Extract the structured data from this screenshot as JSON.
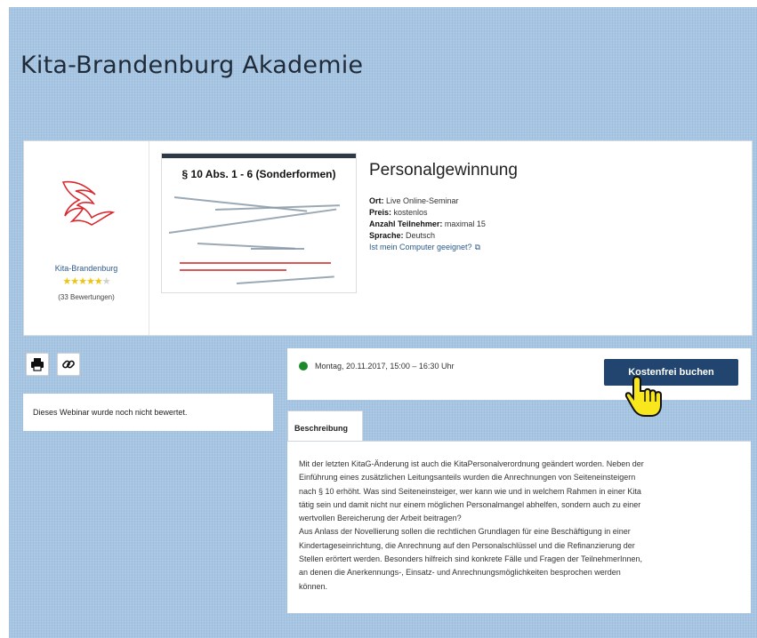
{
  "page": {
    "title": "Kita-Brandenburg Akademie"
  },
  "provider": {
    "name": "Kita-Brandenburg",
    "rating_stars": 5,
    "rating_count_text": "(33 Bewertungen)"
  },
  "thumbnail": {
    "title": "§ 10 Abs. 1 - 6 (Sonderformen)"
  },
  "seminar": {
    "title": "Personalgewinnung",
    "details": [
      {
        "label": "Ort:",
        "value": "Live Online-Seminar"
      },
      {
        "label": "Preis:",
        "value": "kostenlos"
      },
      {
        "label": "Anzahl Teilnehmer:",
        "value": "maximal 15"
      },
      {
        "label": "Sprache:",
        "value": "Deutsch"
      }
    ],
    "computer_check_link": "Ist mein Computer geeignet?"
  },
  "actions": {
    "print_icon": "printer-icon",
    "link_icon": "link-icon"
  },
  "rating_panel": {
    "text": "Dieses Webinar wurde noch nicht bewertet."
  },
  "schedule": {
    "status_color": "#1a8a2a",
    "date_text": "Montag, 20.11.2017, 15:00 – 16:30 Uhr",
    "book_button": "Kostenfrei buchen"
  },
  "tabs": [
    {
      "label": "Beschreibung"
    }
  ],
  "description": {
    "lines": [
      "Mit der letzten KitaG-Änderung ist auch die KitaPersonalverordnung geändert worden. Neben der",
      "Einführung eines zusätzlichen Leitungsanteils wurden die Anrechnungen von Seiteneinsteigern",
      "nach § 10 erhöht. Was sind Seiteneinsteiger, wer kann wie und in welchem Rahmen in einer Kita",
      "tätig sein und damit nicht nur einem möglichen Personalmangel abhelfen, sondern auch zu einer",
      "wertvollen Bereicherung der Arbeit beitragen?",
      "Aus Anlass der Novellierung sollen die rechtlichen Grundlagen für eine Beschäftigung in einer",
      "Kindertageseinrichtung, die Anrechnung auf den Personalschlüssel und die Refinanzierung der",
      "Stellen erörtert werden. Besonders hilfreich sind konkrete Fälle und Fragen der TeilnehmerInnen,",
      "an denen die Anerkennungs-, Einsatz- und Anrechnungsmöglichkeiten besprochen werden",
      "können."
    ]
  },
  "colors": {
    "background": "#a7c6e4",
    "button": "#21456e",
    "link": "#2c5a8a"
  }
}
